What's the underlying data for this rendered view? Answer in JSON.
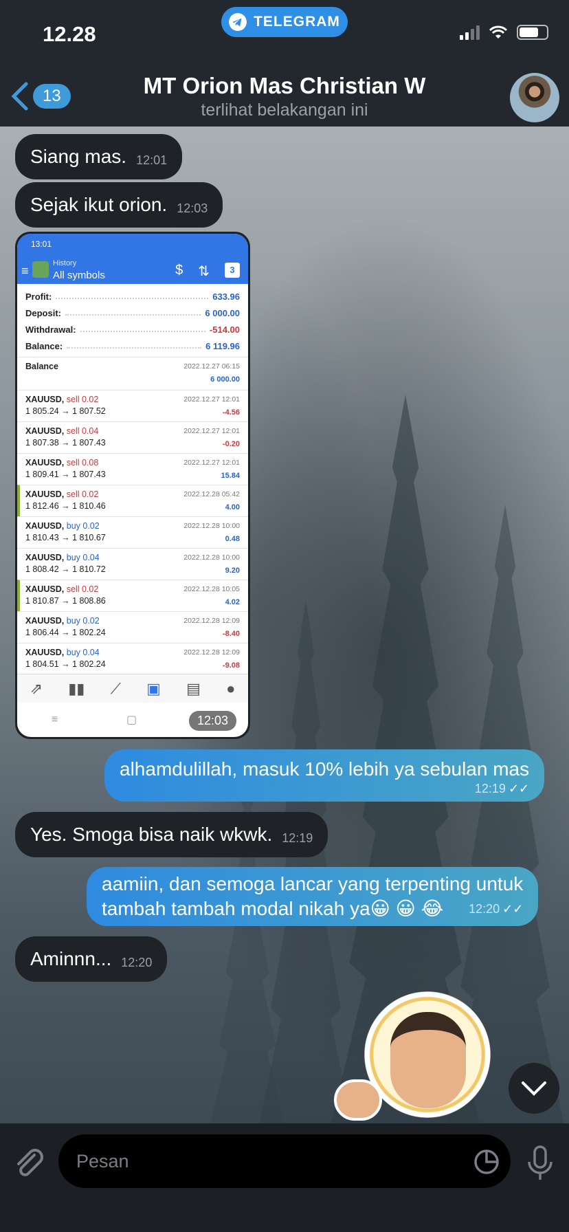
{
  "status_bar": {
    "time": "12.28",
    "pill_label": "TELEGRAM"
  },
  "header": {
    "back_count": "13",
    "title": "MT Orion Mas Christian W",
    "subtitle": "terlihat belakangan ini"
  },
  "messages": [
    {
      "text": "Siang mas.",
      "time": "12:01"
    },
    {
      "text": "Sejak ikut orion.",
      "time": "12:03"
    },
    {
      "screenshot_time": "12:03"
    },
    {
      "text": "alhamdulillah, masuk 10% lebih ya sebulan mas",
      "time": "12:19"
    },
    {
      "text": "Yes. Smoga bisa naik wkwk.",
      "time": "12:19"
    },
    {
      "text_line1": "aamiin, dan semoga lancar yang terpenting untuk",
      "text_line2": "tambah tambah modal nikah ya😀 😀 😂",
      "time": "12:20"
    },
    {
      "text": "Aminnn...",
      "time": "12:20"
    }
  ],
  "screenshot": {
    "status_time": "13:01",
    "header_top": "History",
    "header_main": "All symbols",
    "calendar_day": "3",
    "summary": [
      {
        "label": "Profit:",
        "value": "633.96"
      },
      {
        "label": "Deposit:",
        "value": "6 000.00"
      },
      {
        "label": "Withdrawal:",
        "value": "-514.00"
      },
      {
        "label": "Balance:",
        "value": "6 119.96"
      }
    ],
    "balance_row": {
      "label": "Balance",
      "date": "2022.12.27 06:15",
      "amount": "6 000.00"
    },
    "deals": [
      {
        "sym": "XAUUSD,",
        "side": "sell 0.02",
        "prices": "1 805.24 → 1 807.52",
        "date": "2022.12.27 12:01",
        "pl": "-4.56"
      },
      {
        "sym": "XAUUSD,",
        "side": "sell 0.04",
        "prices": "1 807.38 → 1 807.43",
        "date": "2022.12.27 12:01",
        "pl": "-0.20"
      },
      {
        "sym": "XAUUSD,",
        "side": "sell 0.08",
        "prices": "1 809.41 → 1 807.43",
        "date": "2022.12.27 12:01",
        "pl": "15.84"
      },
      {
        "sym": "XAUUSD,",
        "side": "sell 0.02",
        "prices": "1 812.46 → 1 810.46",
        "date": "2022.12.28 05:42",
        "pl": "4.00"
      },
      {
        "sym": "XAUUSD,",
        "side": "buy 0.02",
        "prices": "1 810.43 → 1 810.67",
        "date": "2022.12.28 10:00",
        "pl": "0.48"
      },
      {
        "sym": "XAUUSD,",
        "side": "buy 0.04",
        "prices": "1 808.42 → 1 810.72",
        "date": "2022.12.28 10:00",
        "pl": "9.20"
      },
      {
        "sym": "XAUUSD,",
        "side": "sell 0.02",
        "prices": "1 810.87 → 1 808.86",
        "date": "2022.12.28 10:05",
        "pl": "4.02"
      },
      {
        "sym": "XAUUSD,",
        "side": "buy 0.02",
        "prices": "1 806.44 → 1 802.24",
        "date": "2022.12.28 12:09",
        "pl": "-8.40"
      },
      {
        "sym": "XAUUSD,",
        "side": "buy 0.04",
        "prices": "1 804.51 → 1 802.24",
        "date": "2022.12.28 12:09",
        "pl": "-9.08"
      }
    ]
  },
  "input": {
    "placeholder": "Pesan"
  },
  "colors": {
    "outgoing_start": "#2e8be0",
    "outgoing_end": "#4aa6c4",
    "incoming": "#1f2226",
    "accent": "#3e9ad9"
  }
}
